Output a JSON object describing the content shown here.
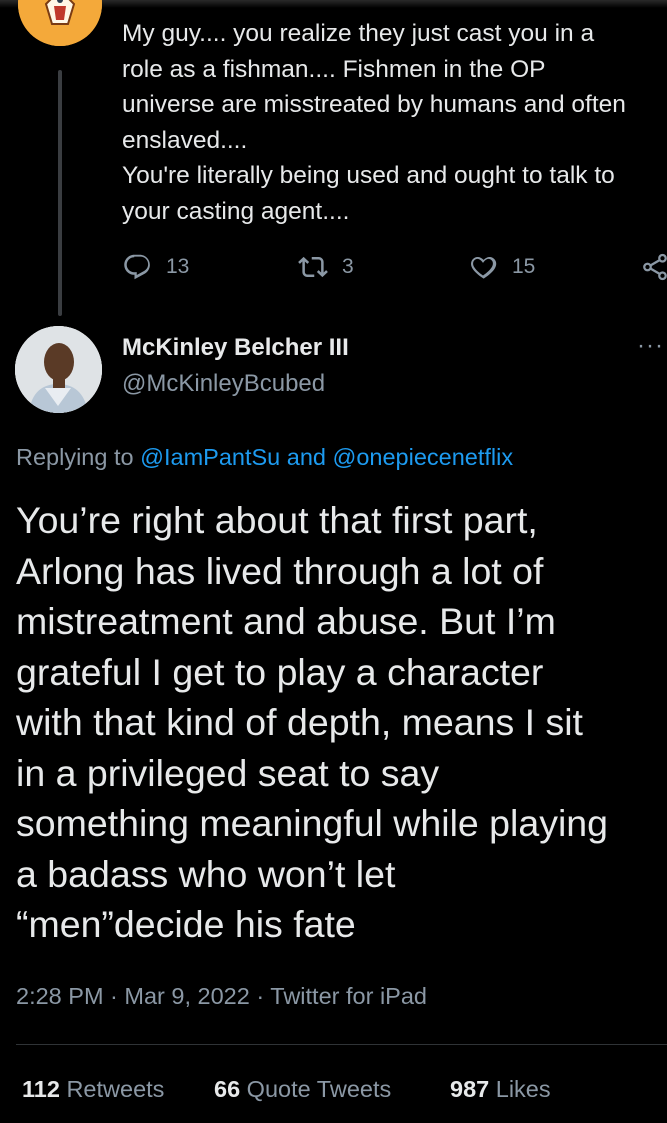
{
  "parent_tweet": {
    "text": "My guy.... you realize they just cast you in a\nrole as a fishman.... Fishmen in the OP\nuniverse are misstreated by humans and often\nenslaved....\nYou're literally being used and ought to talk to\nyour casting agent....",
    "replies": "13",
    "retweets": "3",
    "likes": "15",
    "icons": [
      "reply-icon",
      "retweet-icon",
      "like-icon",
      "share-icon"
    ]
  },
  "tweet": {
    "author_name": "McKinley Belcher III",
    "author_handle": "@McKinleyBcubed",
    "more_label": "···",
    "replying_prefix": "Replying to",
    "replying_to": "@IamPantSu and @onepiecenetflix",
    "text": "You’re right about that first part,\nArlong has lived through a lot of\nmistreatment and abuse. But I’m\ngrateful I get to play a character\nwith that kind of depth, means I sit\nin a privileged seat to say\nsomething meaningful while playing\na badass who won’t let\n“men”decide his fate",
    "meta": "2:28 PM · Mar 9, 2022 · Twitter for iPad",
    "stats": {
      "retweets_count": "112",
      "retweets_label": "Retweets",
      "quotes_count": "66",
      "quotes_label": "Quote Tweets",
      "likes_count": "987",
      "likes_label": "Likes"
    }
  },
  "colors": {
    "background": "#000000",
    "text": "#e7e9ea",
    "muted": "#8b98a5",
    "link": "#1d9bf0"
  }
}
